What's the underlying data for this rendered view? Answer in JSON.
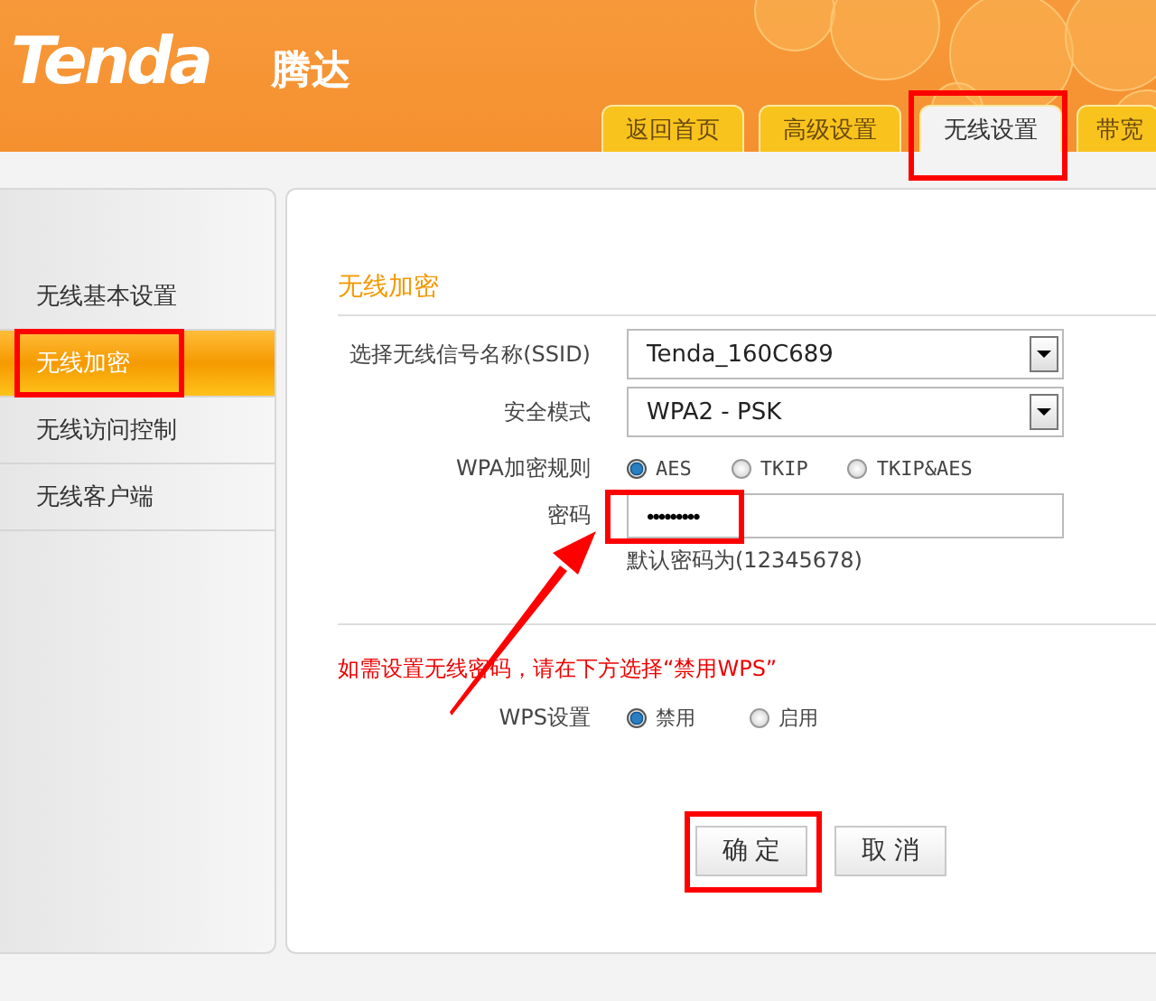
{
  "header": {
    "logo": "Tenda",
    "logo_cn": "腾达"
  },
  "tabs": [
    {
      "label": "返回首页",
      "selected": false,
      "highlighted": false
    },
    {
      "label": "高级设置",
      "selected": false,
      "highlighted": false
    },
    {
      "label": "无线设置",
      "selected": true,
      "highlighted": true
    },
    {
      "label": "带宽",
      "selected": false,
      "highlighted": false
    }
  ],
  "sidebar": {
    "items": [
      {
        "label": "无线基本设置",
        "selected": false,
        "highlighted": false
      },
      {
        "label": "无线加密",
        "selected": true,
        "highlighted": true
      },
      {
        "label": "无线访问控制",
        "selected": false,
        "highlighted": false
      },
      {
        "label": "无线客户端",
        "selected": false,
        "highlighted": false
      }
    ]
  },
  "form": {
    "title": "无线加密",
    "ssid": {
      "label": "选择无线信号名称(SSID)",
      "value": "Tenda_160C689"
    },
    "security_mode": {
      "label": "安全模式",
      "value": "WPA2 - PSK"
    },
    "wpa_rule": {
      "label": "WPA加密规则",
      "options": [
        {
          "label": "AES",
          "selected": true
        },
        {
          "label": "TKIP",
          "selected": false
        },
        {
          "label": "TKIP&AES",
          "selected": false
        }
      ]
    },
    "password": {
      "label": "密码",
      "value": "•••••••••",
      "highlighted": true,
      "hint": "默认密码为(12345678)"
    },
    "notice": "如需设置无线密码，请在下方选择“禁用WPS”",
    "wps": {
      "label": "WPS设置",
      "options": [
        {
          "label": "禁用",
          "selected": true
        },
        {
          "label": "启用",
          "selected": false
        }
      ]
    },
    "buttons": [
      {
        "label": "确 定",
        "highlighted": true
      },
      {
        "label": "取 消",
        "highlighted": false
      }
    ]
  },
  "annotations": {
    "arrow": true
  }
}
